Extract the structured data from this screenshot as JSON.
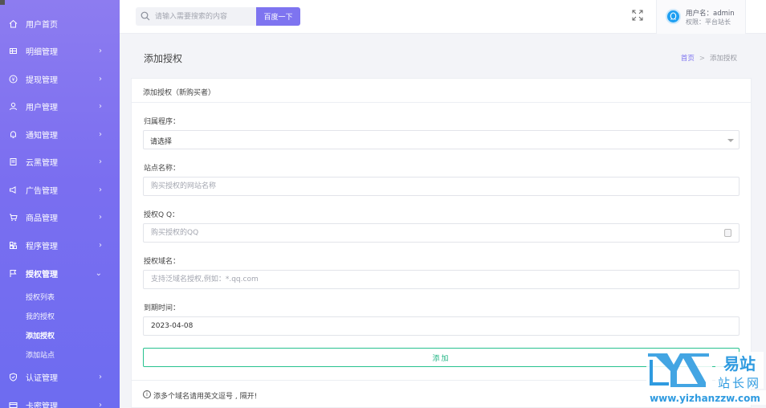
{
  "sidebar": {
    "items": [
      {
        "label": "用户首页",
        "icon": "home-icon"
      },
      {
        "label": "明细管理",
        "icon": "list-icon"
      },
      {
        "label": "提现管理",
        "icon": "withdraw-icon"
      },
      {
        "label": "用户管理",
        "icon": "user-icon"
      },
      {
        "label": "通知管理",
        "icon": "bell-icon"
      },
      {
        "label": "云黑管理",
        "icon": "document-icon"
      },
      {
        "label": "广告管理",
        "icon": "megaphone-icon"
      },
      {
        "label": "商品管理",
        "icon": "cart-icon"
      },
      {
        "label": "程序管理",
        "icon": "app-icon"
      },
      {
        "label": "授权管理",
        "icon": "flag-icon"
      },
      {
        "label": "认证管理",
        "icon": "shield-icon"
      },
      {
        "label": "卡密管理",
        "icon": "card-icon"
      }
    ],
    "submenu": [
      "授权列表",
      "我的授权",
      "添加授权",
      "添加站点"
    ]
  },
  "header": {
    "search_placeholder": "请输入需要搜索的内容",
    "search_button": "百度一下",
    "user_name": "用户名：admin",
    "user_role": "权限：平台站长"
  },
  "page": {
    "title": "添加授权",
    "breadcrumb_home": "首页",
    "breadcrumb_sep": ">",
    "breadcrumb_current": "添加授权"
  },
  "form": {
    "card_title": "添加授权（新购买者）",
    "program_label": "归属程序：",
    "program_value": "请选择",
    "site_name_label": "站点名称：",
    "site_name_placeholder": "购买授权的网站名称",
    "qq_label": "授权Q Q：",
    "qq_placeholder": "购买授权的QQ",
    "domain_label": "授权域名：",
    "domain_placeholder": "支持泛域名授权,例如：*.qq.com",
    "expire_label": "到期时间：",
    "expire_value": "2023-04-08",
    "submit_label": "添加",
    "tip": "添多个域名请用英文逗号 , 隔开!"
  },
  "watermark": {
    "logo": "YZ",
    "name_top": "易站",
    "name_bottom": "站长网",
    "url": "www.yizhanzzw.com"
  },
  "colors": {
    "accent": "#7e74f0",
    "success": "#22b585",
    "avatar": "#1e9ff2"
  }
}
